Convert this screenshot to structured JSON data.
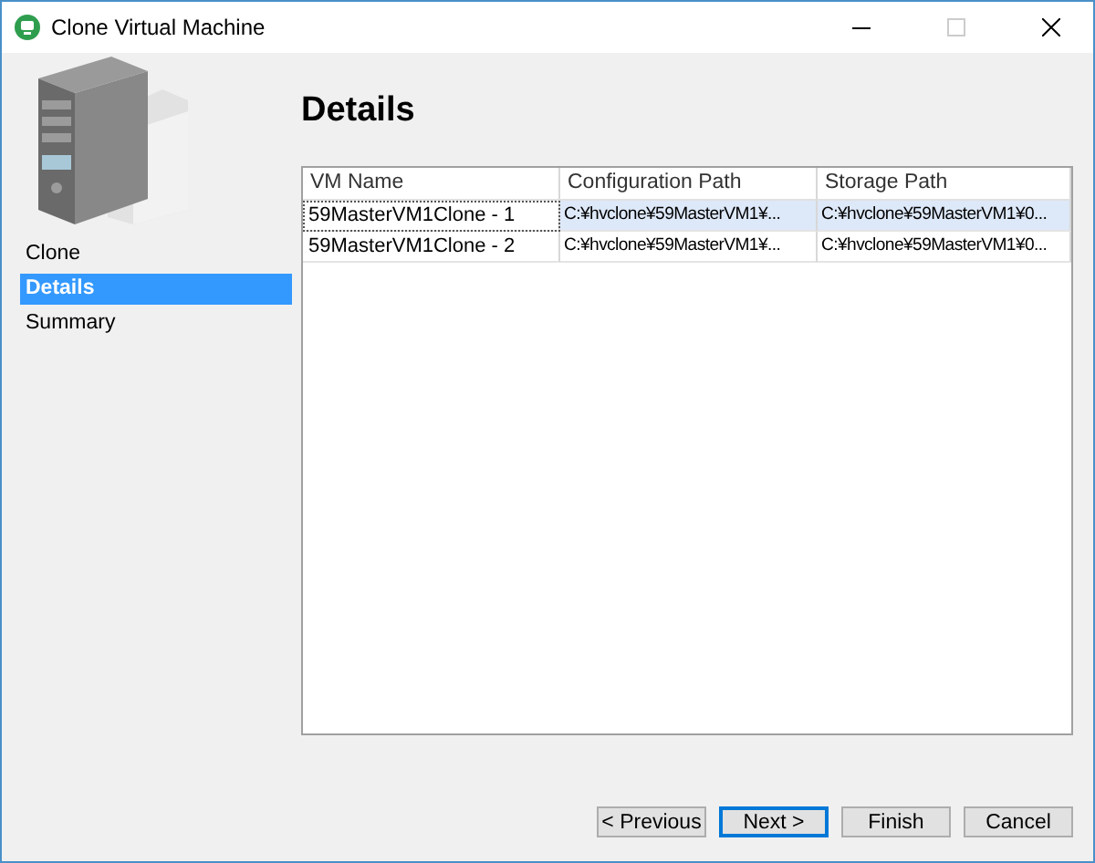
{
  "window": {
    "title": "Clone Virtual Machine"
  },
  "steps": [
    {
      "label": "Clone",
      "selected": false
    },
    {
      "label": "Details",
      "selected": true
    },
    {
      "label": "Summary",
      "selected": false
    }
  ],
  "page_title": "Details",
  "table": {
    "columns": [
      "VM Name",
      "Configuration Path",
      "Storage Path"
    ],
    "rows": [
      {
        "cells": [
          "59MasterVM1Clone - 1",
          "C:¥hvclone¥59MasterVM1¥...",
          "C:¥hvclone¥59MasterVM1¥0..."
        ],
        "selected": true
      },
      {
        "cells": [
          "59MasterVM1Clone - 2",
          "C:¥hvclone¥59MasterVM1¥...",
          "C:¥hvclone¥59MasterVM1¥0..."
        ],
        "selected": false
      }
    ]
  },
  "buttons": [
    {
      "label": "< Previous",
      "default": false
    },
    {
      "label": "Next >",
      "default": true
    },
    {
      "label": "Finish",
      "default": false
    },
    {
      "label": "Cancel",
      "default": false
    }
  ]
}
